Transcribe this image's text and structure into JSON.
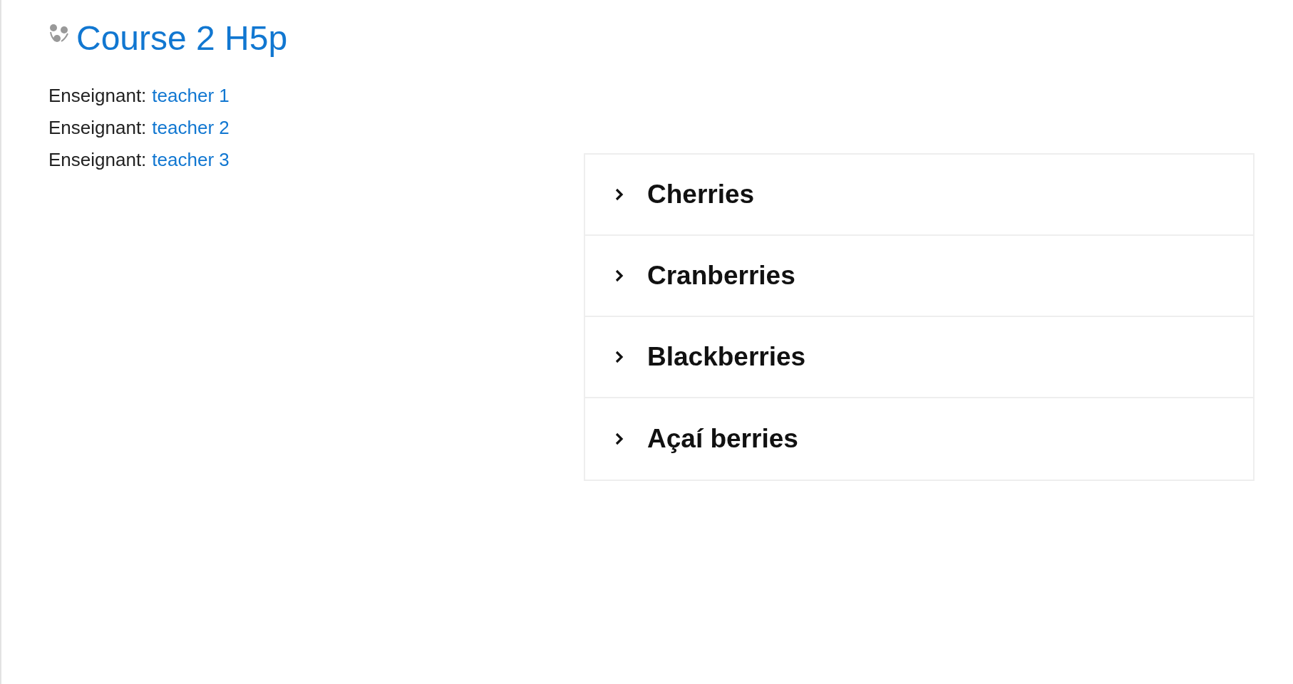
{
  "course": {
    "title": "Course 2 H5p"
  },
  "teachers": [
    {
      "role": "Enseignant:",
      "name": "teacher 1"
    },
    {
      "role": "Enseignant:",
      "name": "teacher 2"
    },
    {
      "role": "Enseignant:",
      "name": "teacher 3"
    }
  ],
  "accordion": [
    {
      "title": "Cherries",
      "expanded": false
    },
    {
      "title": "Cranberries",
      "expanded": false
    },
    {
      "title": "Blackberries",
      "expanded": false
    },
    {
      "title": "Açaí berries",
      "expanded": false
    }
  ]
}
